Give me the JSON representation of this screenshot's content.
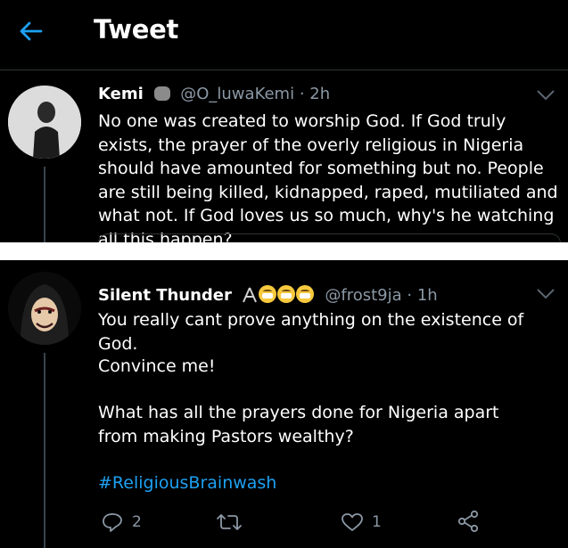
{
  "header": {
    "title": "Tweet",
    "back_icon": "arrow-left-icon"
  },
  "tweet1": {
    "name": "Kemi",
    "handle": "@O_luwaKemi",
    "sep": " · ",
    "time": "2h",
    "text": "No one was created to worship God. If God truly exists, the prayer of the overly religious in Nigeria should have amounted for something but no. People are still being killed, kidnapped, raped, mutiliated and what not. If God loves us so much, why's he watching all this happen?"
  },
  "tweet2": {
    "name": "Silent Thunder",
    "handle": "@frost9ja",
    "sep": " · ",
    "time": "1h",
    "line1": "You really cant prove anything on the existence of God.",
    "line2": "Convince me!",
    "line3": "What has all the prayers done for Nigeria apart from making Pastors wealthy?",
    "hashtag": "#ReligiousBrainwash",
    "reply_count": "2",
    "like_count": "1"
  },
  "colors": {
    "background": "#000000",
    "accent": "#1da1f2",
    "muted": "#8b98a5"
  }
}
